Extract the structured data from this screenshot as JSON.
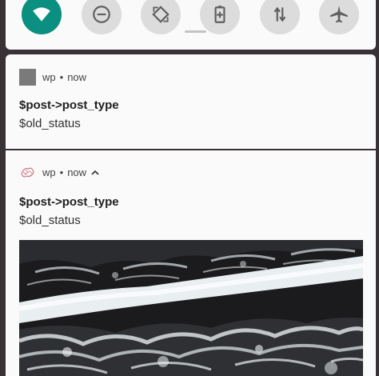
{
  "quick_settings": {
    "tiles": [
      {
        "icon": "wifi-icon",
        "active": true
      },
      {
        "icon": "do-not-disturb-icon",
        "active": false
      },
      {
        "icon": "auto-rotate-icon",
        "active": false
      },
      {
        "icon": "battery-saver-icon",
        "active": false
      },
      {
        "icon": "mobile-data-icon",
        "active": false
      },
      {
        "icon": "airplane-mode-icon",
        "active": false
      }
    ],
    "accent": "#0a8f80"
  },
  "notifications": [
    {
      "app": "wp",
      "time": "now",
      "title": "$post->post_type",
      "body": "$old_status"
    },
    {
      "app": "wp",
      "time": "now",
      "title": "$post->post_type",
      "body": "$old_status",
      "expanded": true,
      "image": "ocean-waves-photo"
    }
  ]
}
